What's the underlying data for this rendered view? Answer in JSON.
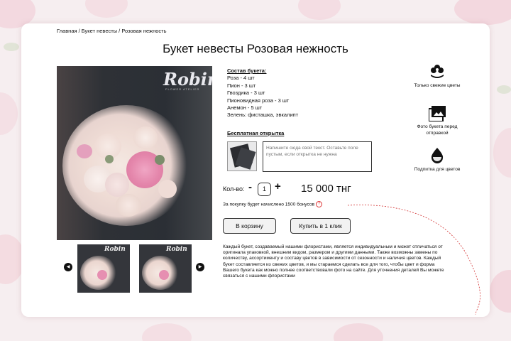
{
  "breadcrumb": "Главная / Букет невесты / Розовая нежность",
  "page_title": "Букет невесты Розовая нежность",
  "photo": {
    "apron_logo": "Robin",
    "apron_sub": "FLOWER ATELIER"
  },
  "composition": {
    "title": "Состав букета:",
    "items": [
      "Роза - 4 шт",
      "Пион - 3 шт",
      "Гвоздика - 3 шт",
      "Пионовидная роза - 3 шт",
      "Анемон - 5 шт",
      "Зелень: фисташка, эвкалипт"
    ]
  },
  "postcard": {
    "title": "Бесплатная открытка",
    "placeholder": "Напишите сюда свой текст. Оставьте поле пустым, если открытка не нужна"
  },
  "quantity": {
    "label": "Кол-во:",
    "minus": "-",
    "value": "1",
    "plus": "+"
  },
  "price": "15 000 тнг",
  "bonus_text": "За покупку будет начислено 1500 бонусов",
  "buttons": {
    "cart": "В корзину",
    "one_click": "Купить в 1 клик"
  },
  "description": "Каждый букет, создаваемый нашими флористами, является индивидуальным и может отличаться от оригинала упаковкой, внешним видом, размером и другими данными. Также возможны замены по количеству, ассортименту и составу цветов в зависимости от сезонности и наличия цветов. Каждый букет составляется из свежих цветов, и мы стараемся сделать все для того, чтобы цвет и форма Вашего букета как можно полнее соответствовали фото на сайте. Для уточнения деталей Вы можете связаться с нашими флористами",
  "features": [
    {
      "icon": "flower-icon",
      "text": "Только свежие цветы"
    },
    {
      "icon": "photos-icon",
      "text": "Фото букета перед отправкой"
    },
    {
      "icon": "water-drop-icon",
      "text": "Подпитка для цветов"
    }
  ],
  "gallery": {
    "prev_icon": "prev-arrow-icon",
    "next_icon": "next-arrow-icon",
    "thumb_logo": "Robin"
  },
  "colors": {
    "background": "#f6eef0",
    "accent_red": "#d33333",
    "button_bg": "#f2f2f2"
  }
}
